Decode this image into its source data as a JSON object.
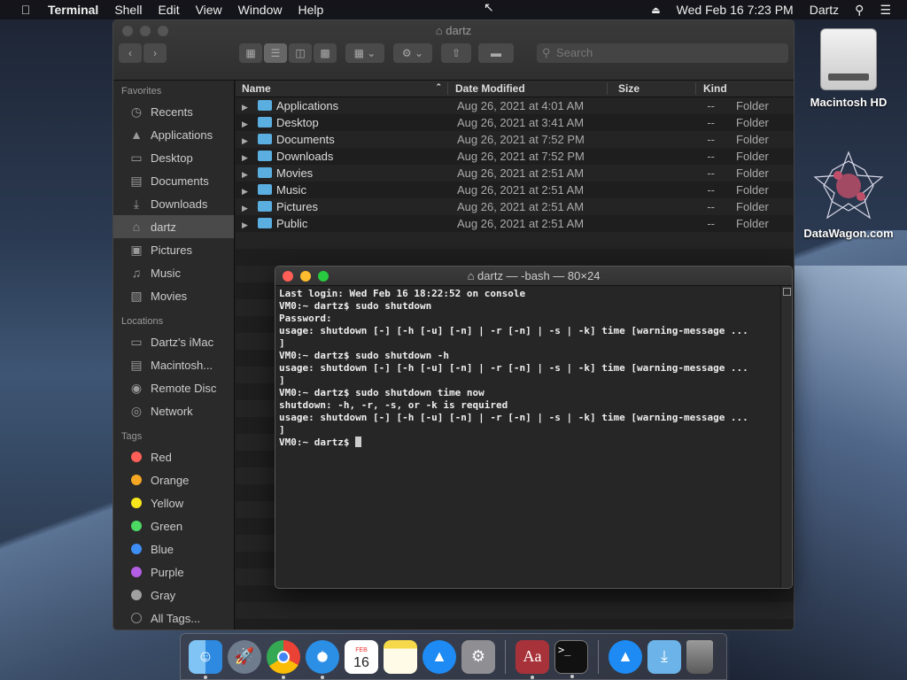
{
  "menubar": {
    "app": "Terminal",
    "items": [
      "Shell",
      "Edit",
      "View",
      "Window",
      "Help"
    ],
    "datetime": "Wed Feb 16  7:23 PM",
    "user": "Dartz"
  },
  "desktop": {
    "icons": [
      {
        "label": "Macintosh HD"
      },
      {
        "label": "DataWagon.com"
      }
    ]
  },
  "finder": {
    "title": "dartz",
    "search_placeholder": "Search",
    "sidebar": {
      "favorites_header": "Favorites",
      "favorites": [
        "Recents",
        "Applications",
        "Desktop",
        "Documents",
        "Downloads",
        "dartz",
        "Pictures",
        "Music",
        "Movies"
      ],
      "locations_header": "Locations",
      "locations": [
        "Dartz's iMac",
        "Macintosh...",
        "Remote Disc",
        "Network"
      ],
      "tags_header": "Tags",
      "tags": [
        {
          "label": "Red",
          "color": "#ff5f57"
        },
        {
          "label": "Orange",
          "color": "#f5a623"
        },
        {
          "label": "Yellow",
          "color": "#f8e71c"
        },
        {
          "label": "Green",
          "color": "#4cd964"
        },
        {
          "label": "Blue",
          "color": "#3d8ef5"
        },
        {
          "label": "Purple",
          "color": "#b45ee6"
        },
        {
          "label": "Gray",
          "color": "#a0a0a0"
        }
      ],
      "all_tags": "All Tags..."
    },
    "columns": {
      "name": "Name",
      "date": "Date Modified",
      "size": "Size",
      "kind": "Kind"
    },
    "rows": [
      {
        "name": "Applications",
        "date": "Aug 26, 2021 at 4:01 AM",
        "size": "--",
        "kind": "Folder"
      },
      {
        "name": "Desktop",
        "date": "Aug 26, 2021 at 3:41 AM",
        "size": "--",
        "kind": "Folder"
      },
      {
        "name": "Documents",
        "date": "Aug 26, 2021 at 7:52 PM",
        "size": "--",
        "kind": "Folder"
      },
      {
        "name": "Downloads",
        "date": "Aug 26, 2021 at 7:52 PM",
        "size": "--",
        "kind": "Folder"
      },
      {
        "name": "Movies",
        "date": "Aug 26, 2021 at 2:51 AM",
        "size": "--",
        "kind": "Folder"
      },
      {
        "name": "Music",
        "date": "Aug 26, 2021 at 2:51 AM",
        "size": "--",
        "kind": "Folder"
      },
      {
        "name": "Pictures",
        "date": "Aug 26, 2021 at 2:51 AM",
        "size": "--",
        "kind": "Folder"
      },
      {
        "name": "Public",
        "date": "Aug 26, 2021 at 2:51 AM",
        "size": "--",
        "kind": "Folder"
      }
    ]
  },
  "terminal": {
    "title": "dartz — -bash — 80×24",
    "lines": [
      "Last login: Wed Feb 16 18:22:52 on console",
      "VM0:~ dartz$ sudo shutdown",
      "Password:",
      "usage: shutdown [-] [-h [-u] [-n] | -r [-n] | -s | -k] time [warning-message ...",
      "]",
      "VM0:~ dartz$ sudo shutdown -h",
      "usage: shutdown [-] [-h [-u] [-n] | -r [-n] | -s | -k] time [warning-message ...",
      "]",
      "VM0:~ dartz$ sudo shutdown time now",
      "shutdown: -h, -r, -s, or -k is required",
      "usage: shutdown [-] [-h [-u] [-n] | -r [-n] | -s | -k] time [warning-message ...",
      "]"
    ],
    "prompt": "VM0:~ dartz$ "
  },
  "dock": {
    "calendar_month": "FEB",
    "calendar_day": "16",
    "dictionary_label": "Aa",
    "terminal_label": ">_",
    "apps": [
      "finder-icon",
      "launchpad-icon",
      "chrome-icon",
      "safari-icon",
      "calendar-icon",
      "notes-icon",
      "app-store-icon",
      "system-preferences-icon",
      "dictionary-icon",
      "terminal-icon",
      "app-store-download-icon",
      "downloads-folder-icon",
      "trash-icon"
    ]
  }
}
